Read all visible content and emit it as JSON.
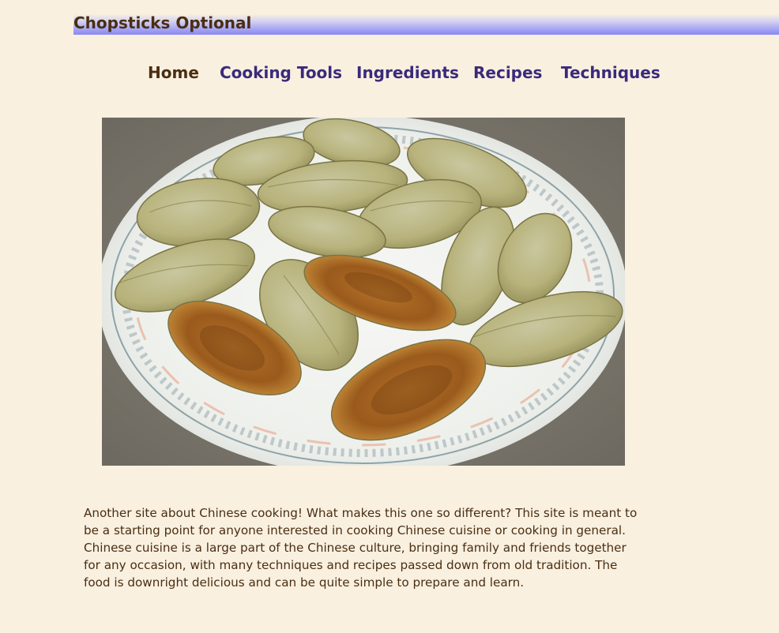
{
  "site": {
    "title": "Chopsticks Optional"
  },
  "nav": {
    "items": [
      {
        "label": "Home",
        "active": true
      },
      {
        "label": "Cooking Tools",
        "active": false
      },
      {
        "label": "Ingredients",
        "active": false
      },
      {
        "label": "Recipes",
        "active": false
      },
      {
        "label": "Techniques",
        "active": false
      }
    ]
  },
  "hero": {
    "subject": "plate of pan-fried dumplings"
  },
  "intro": {
    "text": "Another site about Chinese cooking! What makes this one so different? This site is meant to be a starting point for anyone interested in cooking Chinese cuisine or cooking in general. Chinese cuisine is a large part of the Chinese culture, bringing family and friends together for any occasion, with many techniques and recipes passed down from old tradition. The food is downright delicious and can be quite simple to prepare and learn."
  },
  "colors": {
    "background": "#f9f0e0",
    "title_text": "#4a2e12",
    "nav_active": "#4a2e12",
    "nav_link": "#3b2a7a",
    "title_gradient_end": "#8b89f0"
  }
}
